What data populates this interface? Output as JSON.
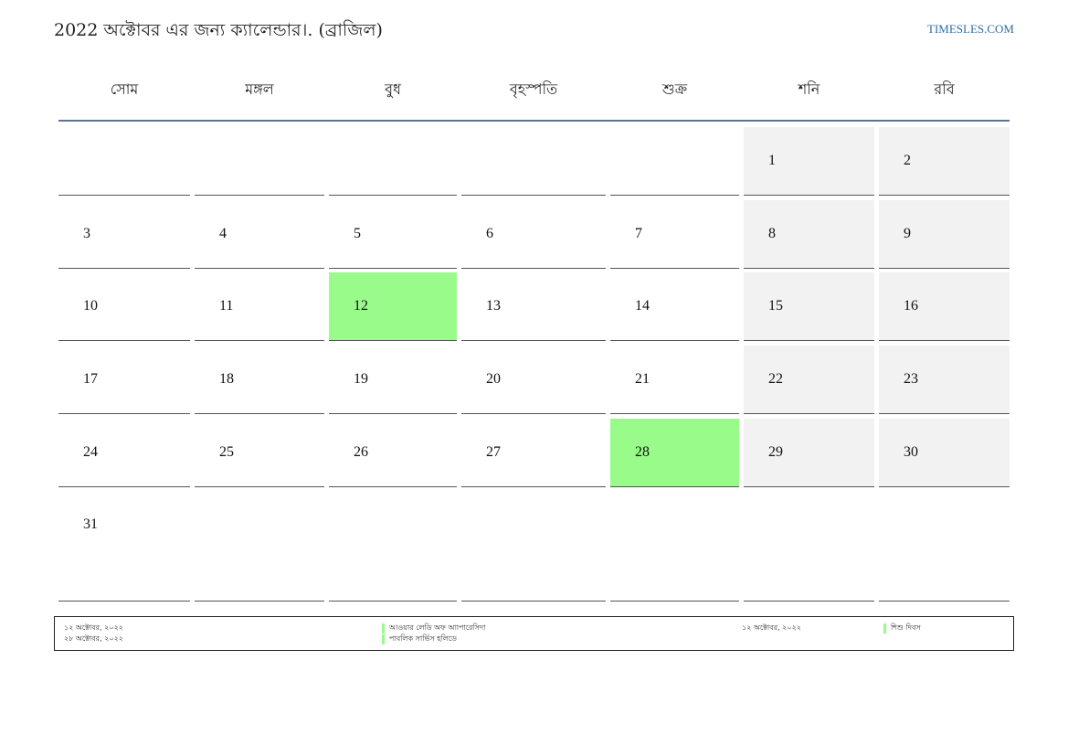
{
  "header": {
    "title": "2022 অক্টোবর এর জন্য ক্যালেন্ডার।. (ব্রাজিল)",
    "brand": "TIMESLES.COM"
  },
  "weekdays": [
    "সোম",
    "মঙ্গল",
    "বুধ",
    "বৃহস্পতি",
    "শুক্র",
    "শনি",
    "রবি"
  ],
  "weeks": [
    [
      "",
      "",
      "",
      "",
      "",
      "1",
      "2"
    ],
    [
      "3",
      "4",
      "5",
      "6",
      "7",
      "8",
      "9"
    ],
    [
      "10",
      "11",
      "12",
      "13",
      "14",
      "15",
      "16"
    ],
    [
      "17",
      "18",
      "19",
      "20",
      "21",
      "22",
      "23"
    ],
    [
      "24",
      "25",
      "26",
      "27",
      "28",
      "29",
      "30"
    ],
    [
      "31",
      "",
      "",
      "",
      "",
      "",
      ""
    ]
  ],
  "highlighted_days": [
    "12",
    "28"
  ],
  "weekend_columns": [
    5,
    6
  ],
  "colors": {
    "holiday": "#98fb8a",
    "weekend": "#f2f2f2",
    "header_rule": "#5a7391",
    "brand": "#2e6da4"
  },
  "legend": {
    "dates_left": [
      "১২ অক্টোবর, ২০২২",
      "২৮ অক্টোবর, ২০২২"
    ],
    "names_left": [
      "আওয়ার লেডি অফ অ্যাপারেসিদা",
      "পাবলিক সার্ভিস হলিডে"
    ],
    "dates_right": [
      "১২ অক্টোবর, ২০২২"
    ],
    "names_right": [
      "শিশু দিবস"
    ]
  }
}
